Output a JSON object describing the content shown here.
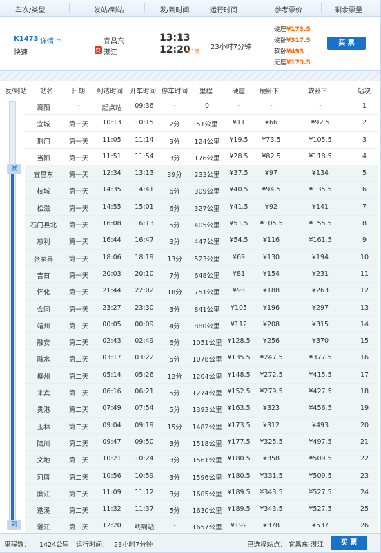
{
  "header": {
    "col_train": "车次/类型",
    "col_stations": "发站/到站",
    "col_times": "发/到时间",
    "col_duration": "运行时间",
    "col_price": "参考票价",
    "col_remain": "剩余票量"
  },
  "train": {
    "number": "K1473",
    "detail_link": "详情 ^",
    "type": "快速",
    "from": "宜昌东",
    "to": "湛江",
    "to_badge": "终",
    "dep_time": "13:13",
    "arr_time": "12:20",
    "plus_day": "+1天",
    "duration": "23小时7分钟",
    "prices": [
      {
        "label": "硬座",
        "value": "¥173.5"
      },
      {
        "label": "硬卧",
        "value": "¥317.5"
      },
      {
        "label": "软卧",
        "value": "¥493"
      },
      {
        "label": "无座",
        "value": "¥173.5"
      }
    ],
    "buy_label": "买 票"
  },
  "stop_table": {
    "col_from_to": "发/到站",
    "col_station": "站名",
    "col_day": "日期",
    "col_arrive": "到达时间",
    "col_depart": "开车时间",
    "col_stop": "停车时间",
    "col_distance": "里程",
    "col_hard_seat": "硬座",
    "col_hard_sleeper": "硬卧下",
    "col_soft_sleeper": "软卧下",
    "col_index": "站次",
    "tag_depart": "发",
    "tag_arrive": "到",
    "rows": [
      {
        "name": "襄阳",
        "day": "-",
        "arr": "起点站",
        "dep": "09:36",
        "stop": "-",
        "dist": "0",
        "hard": "-",
        "hsl": "-",
        "ssl": "-",
        "no": "1",
        "hl": false
      },
      {
        "name": "宜城",
        "day": "第一天",
        "arr": "10:13",
        "dep": "10:15",
        "stop": "2分",
        "dist": "51公里",
        "hard": "¥11",
        "hsl": "¥66",
        "ssl": "¥92.5",
        "no": "2",
        "hl": false
      },
      {
        "name": "荆门",
        "day": "第一天",
        "arr": "11:05",
        "dep": "11:14",
        "stop": "9分",
        "dist": "124公里",
        "hard": "¥19.5",
        "hsl": "¥73.5",
        "ssl": "¥105.5",
        "no": "3",
        "hl": false
      },
      {
        "name": "当阳",
        "day": "第一天",
        "arr": "11:51",
        "dep": "11:54",
        "stop": "3分",
        "dist": "176公里",
        "hard": "¥28.5",
        "hsl": "¥82.5",
        "ssl": "¥118.5",
        "no": "4",
        "hl": false
      },
      {
        "name": "宜昌东",
        "day": "第一天",
        "arr": "12:34",
        "dep": "13:13",
        "stop": "39分",
        "dist": "233公里",
        "hard": "¥37.5",
        "hsl": "¥97",
        "ssl": "¥134",
        "no": "5",
        "hl": true
      },
      {
        "name": "枝城",
        "day": "第一天",
        "arr": "14:35",
        "dep": "14:41",
        "stop": "6分",
        "dist": "309公里",
        "hard": "¥40.5",
        "hsl": "¥94.5",
        "ssl": "¥135.5",
        "no": "6",
        "hl": true
      },
      {
        "name": "松滋",
        "day": "第一天",
        "arr": "14:55",
        "dep": "15:01",
        "stop": "6分",
        "dist": "327公里",
        "hard": "¥41.5",
        "hsl": "¥92",
        "ssl": "¥141",
        "no": "7",
        "hl": true
      },
      {
        "name": "石门县北",
        "day": "第一天",
        "arr": "16:08",
        "dep": "16:13",
        "stop": "5分",
        "dist": "405公里",
        "hard": "¥51.5",
        "hsl": "¥105.5",
        "ssl": "¥155.5",
        "no": "8",
        "hl": true
      },
      {
        "name": "慈利",
        "day": "第一天",
        "arr": "16:44",
        "dep": "16:47",
        "stop": "3分",
        "dist": "447公里",
        "hard": "¥54.5",
        "hsl": "¥116",
        "ssl": "¥161.5",
        "no": "9",
        "hl": true
      },
      {
        "name": "张家界",
        "day": "第一天",
        "arr": "18:06",
        "dep": "18:19",
        "stop": "13分",
        "dist": "523公里",
        "hard": "¥69",
        "hsl": "¥130",
        "ssl": "¥194",
        "no": "10",
        "hl": true
      },
      {
        "name": "吉首",
        "day": "第一天",
        "arr": "20:03",
        "dep": "20:10",
        "stop": "7分",
        "dist": "648公里",
        "hard": "¥81",
        "hsl": "¥154",
        "ssl": "¥231",
        "no": "11",
        "hl": true
      },
      {
        "name": "怀化",
        "day": "第一天",
        "arr": "21:44",
        "dep": "22:02",
        "stop": "18分",
        "dist": "751公里",
        "hard": "¥93",
        "hsl": "¥188",
        "ssl": "¥263",
        "no": "12",
        "hl": true
      },
      {
        "name": "会同",
        "day": "第一天",
        "arr": "23:27",
        "dep": "23:30",
        "stop": "3分",
        "dist": "841公里",
        "hard": "¥105",
        "hsl": "¥196",
        "ssl": "¥297",
        "no": "13",
        "hl": true
      },
      {
        "name": "靖州",
        "day": "第二天",
        "arr": "00:05",
        "dep": "00:09",
        "stop": "4分",
        "dist": "880公里",
        "hard": "¥112",
        "hsl": "¥208",
        "ssl": "¥315",
        "no": "14",
        "hl": true
      },
      {
        "name": "融安",
        "day": "第二天",
        "arr": "02:43",
        "dep": "02:49",
        "stop": "6分",
        "dist": "1051公里",
        "hard": "¥128.5",
        "hsl": "¥256",
        "ssl": "¥370",
        "no": "15",
        "hl": true
      },
      {
        "name": "融水",
        "day": "第二天",
        "arr": "03:17",
        "dep": "03:22",
        "stop": "5分",
        "dist": "1078公里",
        "hard": "¥135.5",
        "hsl": "¥247.5",
        "ssl": "¥377.5",
        "no": "16",
        "hl": true
      },
      {
        "name": "柳州",
        "day": "第二天",
        "arr": "05:14",
        "dep": "05:26",
        "stop": "12分",
        "dist": "1204公里",
        "hard": "¥148.5",
        "hsl": "¥272.5",
        "ssl": "¥415.5",
        "no": "17",
        "hl": true
      },
      {
        "name": "来宾",
        "day": "第二天",
        "arr": "06:16",
        "dep": "06:21",
        "stop": "5分",
        "dist": "1274公里",
        "hard": "¥152.5",
        "hsl": "¥279.5",
        "ssl": "¥427.5",
        "no": "18",
        "hl": true
      },
      {
        "name": "贵港",
        "day": "第二天",
        "arr": "07:49",
        "dep": "07:54",
        "stop": "5分",
        "dist": "1393公里",
        "hard": "¥163.5",
        "hsl": "¥323",
        "ssl": "¥456.5",
        "no": "19",
        "hl": true
      },
      {
        "name": "玉林",
        "day": "第二天",
        "arr": "09:04",
        "dep": "09:19",
        "stop": "15分",
        "dist": "1482公里",
        "hard": "¥173.5",
        "hsl": "¥312",
        "ssl": "¥493",
        "no": "20",
        "hl": true
      },
      {
        "name": "陆川",
        "day": "第二天",
        "arr": "09:47",
        "dep": "09:50",
        "stop": "3分",
        "dist": "1518公里",
        "hard": "¥177.5",
        "hsl": "¥325.5",
        "ssl": "¥497.5",
        "no": "21",
        "hl": true
      },
      {
        "name": "文地",
        "day": "第二天",
        "arr": "10:21",
        "dep": "10:24",
        "stop": "3分",
        "dist": "1561公里",
        "hard": "¥180.5",
        "hsl": "¥358",
        "ssl": "¥509.5",
        "no": "22",
        "hl": true
      },
      {
        "name": "河唇",
        "day": "第二天",
        "arr": "10:56",
        "dep": "10:59",
        "stop": "3分",
        "dist": "1596公里",
        "hard": "¥180.5",
        "hsl": "¥331.5",
        "ssl": "¥509.5",
        "no": "23",
        "hl": true
      },
      {
        "name": "廉江",
        "day": "第二天",
        "arr": "11:09",
        "dep": "11:12",
        "stop": "3分",
        "dist": "1605公里",
        "hard": "¥189.5",
        "hsl": "¥343.5",
        "ssl": "¥527.5",
        "no": "24",
        "hl": true
      },
      {
        "name": "遂溪",
        "day": "第二天",
        "arr": "11:32",
        "dep": "11:37",
        "stop": "5分",
        "dist": "1630公里",
        "hard": "¥189.5",
        "hsl": "¥343.5",
        "ssl": "¥527.5",
        "no": "25",
        "hl": true
      },
      {
        "name": "湛江",
        "day": "第二天",
        "arr": "12:20",
        "dep": "终到站",
        "stop": "-",
        "dist": "1657公里",
        "hard": "¥192",
        "hsl": "¥378",
        "ssl": "¥537",
        "no": "26",
        "hl": true
      }
    ]
  },
  "footer": {
    "distance_label": "里程数：",
    "distance_value": "1424公里",
    "duration_label": "运行时间：",
    "duration_value": "23小时7分钟",
    "selected_label": "已选择站点：",
    "selected_value": "宜昌东-湛江",
    "buy_label": "买 票"
  }
}
